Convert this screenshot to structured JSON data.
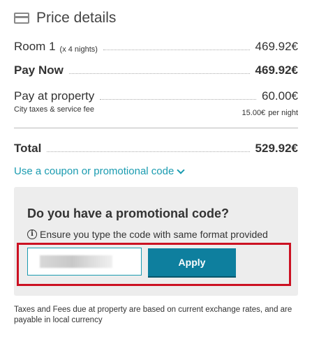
{
  "header": {
    "title": "Price details",
    "icon": "credit-card-icon"
  },
  "room": {
    "label": "Room 1",
    "nights": "(x 4 nights)",
    "value": "469.92€"
  },
  "pay_now": {
    "label": "Pay Now",
    "value": "469.92€"
  },
  "pay_at_property": {
    "label": "Pay at property",
    "value": "60.00€",
    "sublabel": "City taxes & service fee",
    "per_night_amount": "15.00€",
    "per_night_unit": "per night"
  },
  "total": {
    "label": "Total",
    "value": "529.92€"
  },
  "coupon_link": {
    "label": "Use a coupon or promotional code",
    "icon": "chevron-down-icon"
  },
  "promo": {
    "title": "Do you have a promotional code?",
    "hint": "Ensure you type the code with same format provided",
    "input_value": "",
    "apply_label": "Apply"
  },
  "footnote": "Taxes and Fees due at property are based on current exchange rates, and are payable in local currency",
  "colors": {
    "accent": "#1a9bb0",
    "button": "#0e7f9e",
    "highlight": "#cc1122",
    "panel": "#ededed"
  }
}
